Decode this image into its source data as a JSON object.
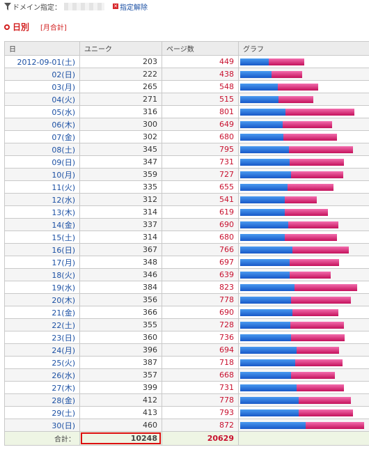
{
  "filter": {
    "icon": "filter-icon",
    "label": "ドメイン指定：",
    "clear_label": "指定解除",
    "clear_icon": "clear-icon"
  },
  "section": {
    "title": "日別",
    "monthly_link": "[月合計]",
    "icon": "radio-dot-icon"
  },
  "table": {
    "headers": [
      "日",
      "ユニーク",
      "ページ数",
      "グラフ"
    ],
    "rows": [
      {
        "date": "2012-09-01(土)",
        "unique": 203,
        "pages": 449
      },
      {
        "date": "02(日)",
        "unique": 222,
        "pages": 438
      },
      {
        "date": "03(月)",
        "unique": 265,
        "pages": 548
      },
      {
        "date": "04(火)",
        "unique": 271,
        "pages": 515
      },
      {
        "date": "05(水)",
        "unique": 316,
        "pages": 801
      },
      {
        "date": "06(木)",
        "unique": 300,
        "pages": 649
      },
      {
        "date": "07(金)",
        "unique": 302,
        "pages": 680
      },
      {
        "date": "08(土)",
        "unique": 345,
        "pages": 795
      },
      {
        "date": "09(日)",
        "unique": 347,
        "pages": 731
      },
      {
        "date": "10(月)",
        "unique": 359,
        "pages": 727
      },
      {
        "date": "11(火)",
        "unique": 335,
        "pages": 655
      },
      {
        "date": "12(水)",
        "unique": 312,
        "pages": 541
      },
      {
        "date": "13(木)",
        "unique": 314,
        "pages": 619
      },
      {
        "date": "14(金)",
        "unique": 337,
        "pages": 690
      },
      {
        "date": "15(土)",
        "unique": 314,
        "pages": 680
      },
      {
        "date": "16(日)",
        "unique": 367,
        "pages": 766
      },
      {
        "date": "17(月)",
        "unique": 348,
        "pages": 697
      },
      {
        "date": "18(火)",
        "unique": 346,
        "pages": 639
      },
      {
        "date": "19(水)",
        "unique": 384,
        "pages": 823
      },
      {
        "date": "20(木)",
        "unique": 356,
        "pages": 778
      },
      {
        "date": "21(金)",
        "unique": 366,
        "pages": 690
      },
      {
        "date": "22(土)",
        "unique": 355,
        "pages": 728
      },
      {
        "date": "23(日)",
        "unique": 360,
        "pages": 736
      },
      {
        "date": "24(月)",
        "unique": 396,
        "pages": 694
      },
      {
        "date": "25(火)",
        "unique": 387,
        "pages": 718
      },
      {
        "date": "26(水)",
        "unique": 357,
        "pages": 668
      },
      {
        "date": "27(木)",
        "unique": 399,
        "pages": 731
      },
      {
        "date": "28(金)",
        "unique": 412,
        "pages": 778
      },
      {
        "date": "29(土)",
        "unique": 413,
        "pages": 793
      },
      {
        "date": "30(日)",
        "unique": 460,
        "pages": 872
      }
    ],
    "total": {
      "label": "合計：",
      "unique": "10248",
      "pages": "20629"
    }
  },
  "colors": {
    "unique_bar": "#1858c8",
    "pages_bar": "#c4115b",
    "accent": "#d21e1e",
    "link": "#1a4fa3"
  }
}
